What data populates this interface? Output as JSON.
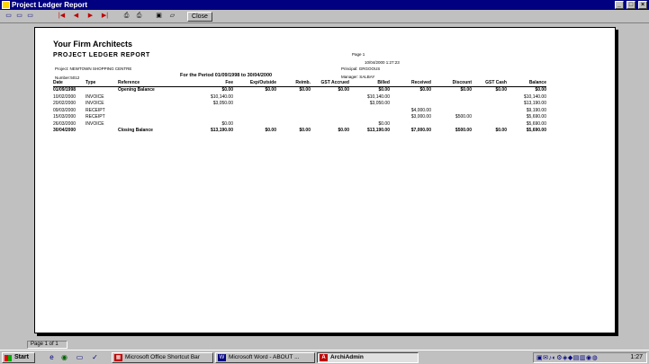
{
  "window": {
    "title": "Project Ledger Report"
  },
  "toolbar": {
    "close_label": "Close"
  },
  "report": {
    "firm": "Your Firm Architects",
    "title": "PROJECT LEDGER REPORT",
    "page": "Page 1",
    "datetime": "10/04/2000 1:27:23",
    "project": "Project: NEWTOWN SHOPPING CENTRE",
    "principal": "Principal: GRGOOUS",
    "number": "Number:5012",
    "period": "For the Period 01/09/1998 to 30/04/2000",
    "manager": "Manager: SALBAY",
    "columns": [
      "Date",
      "Type",
      "Reference",
      "Fee",
      "Exp/Outside",
      "Reimb.",
      "GST Accrued",
      "Billed",
      "Received",
      "Discount",
      "GST Cash",
      "Balance"
    ],
    "rows": [
      {
        "bold": true,
        "cells": [
          "01/09/1998",
          "",
          "Opening Balance",
          "$0.00",
          "$0.00",
          "$0.00",
          "$0.00",
          "$0.00",
          "$0.00",
          "$0.00",
          "$0.00",
          "$0.00"
        ]
      },
      {
        "bold": false,
        "cells": [
          "10/02/2000",
          "INVOICE",
          "",
          "$10,140.00",
          "",
          "",
          "",
          "$10,140.00",
          "",
          "",
          "",
          "$10,140.00"
        ]
      },
      {
        "bold": false,
        "cells": [
          "20/02/2000",
          "INVOICE",
          "",
          "$3,050.00",
          "",
          "",
          "",
          "$3,050.00",
          "",
          "",
          "",
          "$13,190.00"
        ]
      },
      {
        "bold": false,
        "cells": [
          "09/03/2000",
          "RECEIPT",
          "",
          "",
          "",
          "",
          "",
          "",
          "$4,000.00",
          "",
          "",
          "$9,190.00"
        ]
      },
      {
        "bold": false,
        "cells": [
          "15/03/2000",
          "RECEIPT",
          "",
          "",
          "",
          "",
          "",
          "",
          "$3,000.00",
          "$500.00",
          "",
          "$5,690.00"
        ]
      },
      {
        "bold": false,
        "cells": [
          "26/03/2000",
          "INVOICE",
          "",
          "$0.00",
          "",
          "",
          "",
          "$0.00",
          "",
          "",
          "",
          "$5,690.00"
        ]
      },
      {
        "bold": true,
        "cells": [
          "30/04/2000",
          "",
          "Closing Balance",
          "$13,190.00",
          "$0.00",
          "$0.00",
          "$0.00",
          "$13,190.00",
          "$7,000.00",
          "$500.00",
          "$0.00",
          "$5,690.00"
        ]
      }
    ]
  },
  "status": {
    "page_indicator": "Page 1 of 1"
  },
  "taskbar": {
    "start_label": "Start",
    "tasks": [
      {
        "label": "Microsoft Office Shortcut Bar",
        "active": false
      },
      {
        "label": "Microsoft Word - ABOUT ...",
        "active": false
      },
      {
        "label": "ArchiAdmin",
        "active": true
      }
    ],
    "clock": "1:27"
  },
  "colors": {
    "titlebar": "#000080",
    "chrome": "#c0c0c0",
    "nav_arrows": "#c00000"
  }
}
